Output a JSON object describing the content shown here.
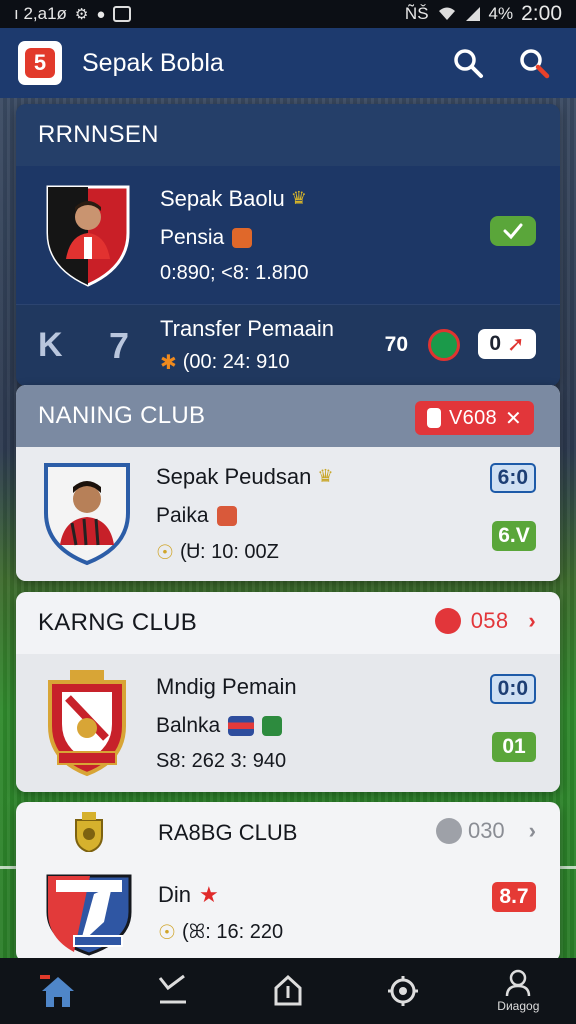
{
  "status": {
    "left_text": "ı 2,a1ø",
    "right_text": "ÑŠ",
    "battery": "4%",
    "time": "2:00"
  },
  "app": {
    "logo_letter": "5",
    "title": "Sepak Bobla",
    "accent": "#e23a2b",
    "bar_color": "#1d3a6e"
  },
  "section1": {
    "header": "RRNNSEN",
    "player": {
      "name": "Sepak Baolu",
      "sub": "Pensia",
      "meta": "0:890; <8: 1.8Ŋ0"
    },
    "transfer": {
      "left_letter": "K",
      "left_number": "7",
      "title": "Transfer Pemaain",
      "meta": "(00: 24: 910",
      "score": "70",
      "badge": "0"
    }
  },
  "section2": {
    "header": "NANING CLUB",
    "header_badge": "V608",
    "player": {
      "name": "Sepak Peudsan",
      "sub": "Paika",
      "meta": "(Ꮜ: 10: 00Z"
    },
    "score_top": "6:0",
    "score_bottom": "6.V"
  },
  "section3": {
    "header": "KARNG CLUB",
    "header_badge": "058",
    "player": {
      "name": "Mndig Pemain",
      "sub": "Balnka",
      "meta": "S8: 262 3: 940"
    },
    "score_top": "0:0",
    "score_bottom": "01"
  },
  "section4": {
    "header": "RA8BG CLUB",
    "header_badge": "030",
    "player": {
      "name": "Din",
      "meta": "(ꕤ: 16: 220"
    },
    "score": "8.7"
  },
  "nav": {
    "items": [
      {
        "name": "home",
        "label": ""
      },
      {
        "name": "check",
        "label": ""
      },
      {
        "name": "upload",
        "label": ""
      },
      {
        "name": "settings",
        "label": ""
      },
      {
        "name": "profile",
        "label": "Dиagog"
      }
    ]
  }
}
